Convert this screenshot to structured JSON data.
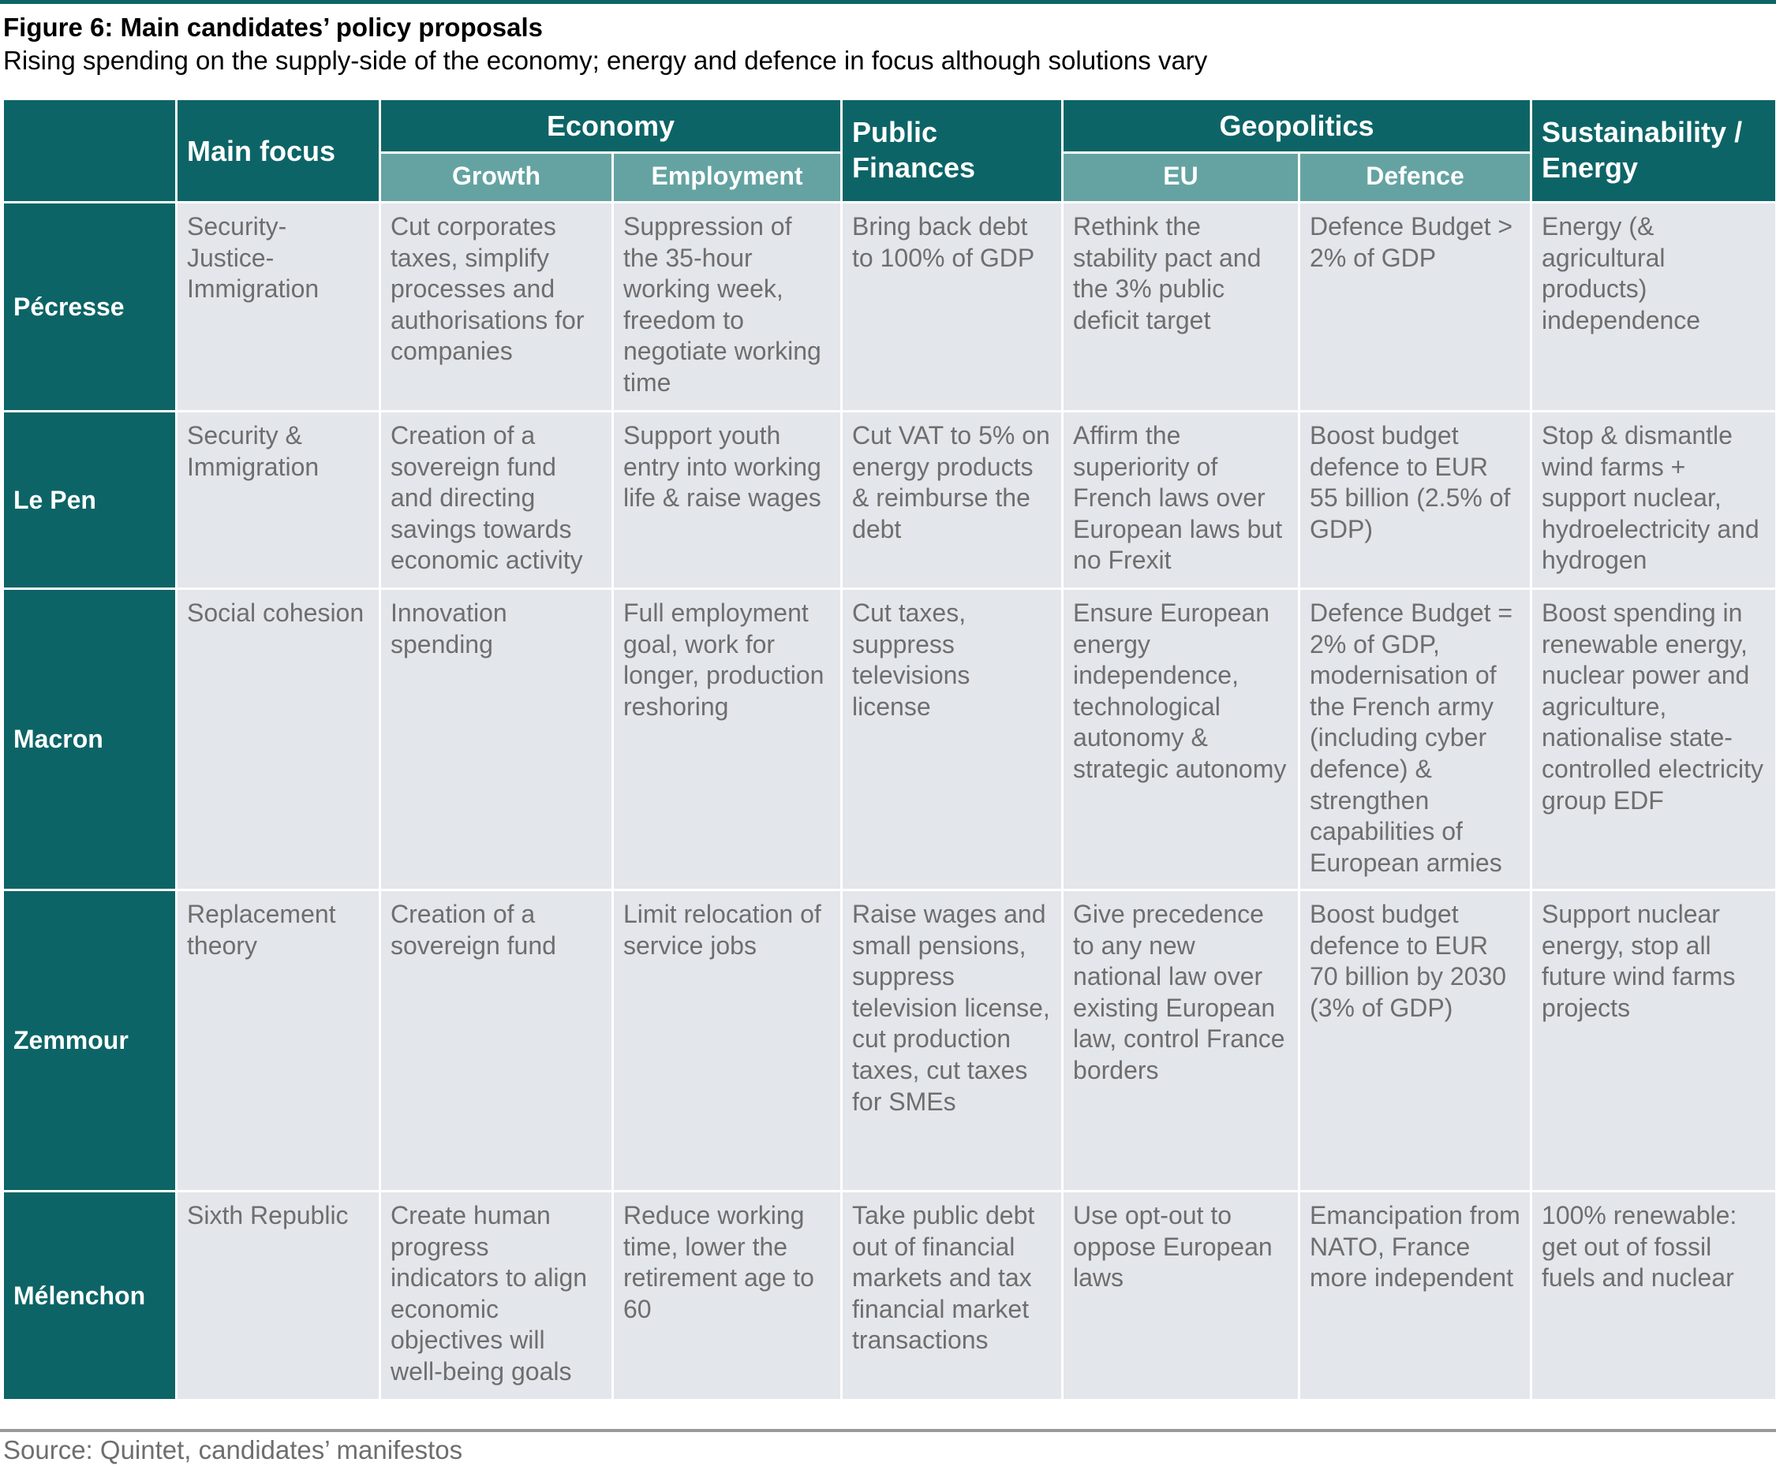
{
  "figure": {
    "title": "Figure 6: Main candidates’ policy proposals",
    "subtitle": "Rising spending on the supply-side of the economy; energy and defence in focus although solutions vary",
    "source": "Source: Quintet, candidates’ manifestos"
  },
  "header": {
    "main_focus": "Main focus",
    "economy": "Economy",
    "public_finances": "Public Finances",
    "geopolitics": "Geopolitics",
    "sustainability": "Sustainability / Energy",
    "growth": "Growth",
    "employment": "Employment",
    "eu": "EU",
    "defence": "Defence"
  },
  "rows": [
    {
      "candidate": "Pécresse",
      "main_focus": "Security-Justice-Immigration",
      "growth": "Cut corporates taxes, simplify processes and authorisations for companies",
      "employment": "Suppression of the 35-hour working week, freedom to negotiate working time",
      "public_finances": "Bring back debt to 100% of GDP",
      "eu": "Rethink the stability pact and the 3% public deficit target",
      "defence": "Defence Budget > 2% of GDP",
      "sustainability": "Energy (& agricultural products) independence"
    },
    {
      "candidate": "Le Pen",
      "main_focus": "Security & Immigration",
      "growth": "Creation of a sovereign fund and directing savings towards economic activity",
      "employment": "Support youth entry into working life & raise wages",
      "public_finances": "Cut VAT to 5% on energy products & reimburse the debt",
      "eu": "Affirm the superiority of French laws over European laws but no Frexit",
      "defence": "Boost budget defence to EUR 55 billion (2.5% of GDP)",
      "sustainability": "Stop & dismantle wind farms + support nuclear, hydroelectricity and hydrogen"
    },
    {
      "candidate": "Macron",
      "main_focus": "Social cohesion",
      "growth": "Innovation spending",
      "employment": "Full employment goal, work for longer, production reshoring",
      "public_finances": "Cut taxes, suppress televisions license",
      "eu": "Ensure European energy independence, technological autonomy & strategic autonomy",
      "defence": "Defence Budget = 2% of GDP, modernisation of the French army (including cyber defence) & strengthen capabilities of European armies",
      "sustainability": "Boost spending in renewable energy, nuclear power and agriculture, nationalise state-controlled electricity group EDF"
    },
    {
      "candidate": "Zemmour",
      "main_focus": "Replacement theory",
      "growth": "Creation of a sovereign fund",
      "employment": "Limit relocation of service jobs",
      "public_finances": "Raise wages and small pensions, suppress television license, cut production taxes, cut taxes for SMEs",
      "eu": "Give precedence to any new national law over existing European law, control France borders",
      "defence": "Boost budget defence to EUR 70 billion by 2030 (3% of GDP)",
      "sustainability": "Support nuclear energy, stop all future wind farms projects"
    },
    {
      "candidate": "Mélenchon",
      "main_focus": "Sixth Republic",
      "growth": "Create human progress indicators to align economic objectives will well-being goals",
      "employment": "Reduce working time, lower the retirement age to 60",
      "public_finances": "Take public debt out of financial markets and tax financial market transactions",
      "eu": "Use opt-out to oppose European laws",
      "defence": "Emancipation from NATO, France more independent",
      "sustainability": "100% renewable: get out of fossil fuels and nuclear"
    }
  ]
}
